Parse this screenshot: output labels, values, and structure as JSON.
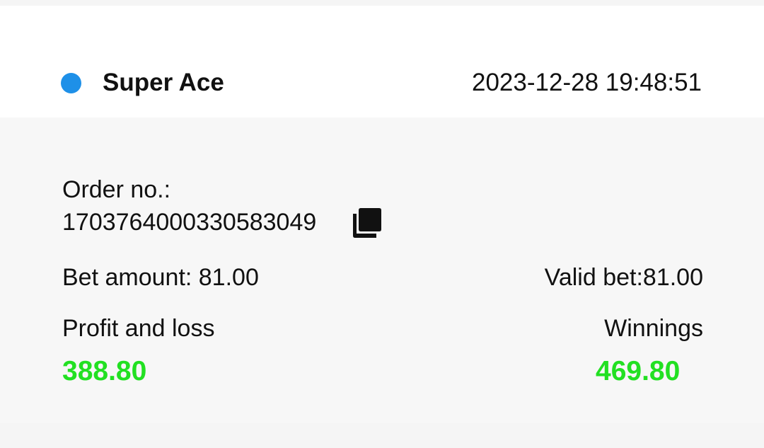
{
  "record": {
    "game_name": "Super Ace",
    "datetime": "2023-12-28 19:48:51",
    "order_label": "Order no.:",
    "order_number": "1703764000330583049",
    "bet_amount": "Bet amount: 81.00",
    "valid_bet": "Valid bet:81.00",
    "profit_loss_label": "Profit and loss",
    "profit_loss_value": "388.80",
    "winnings_label": "Winnings",
    "winnings_value": "469.80"
  },
  "icons": {
    "status_dot": "status-dot",
    "copy": "copy-icon"
  },
  "colors": {
    "status_dot": "#1e90e8",
    "positive_amount": "#22e022",
    "details_background": "#f7f7f7"
  }
}
